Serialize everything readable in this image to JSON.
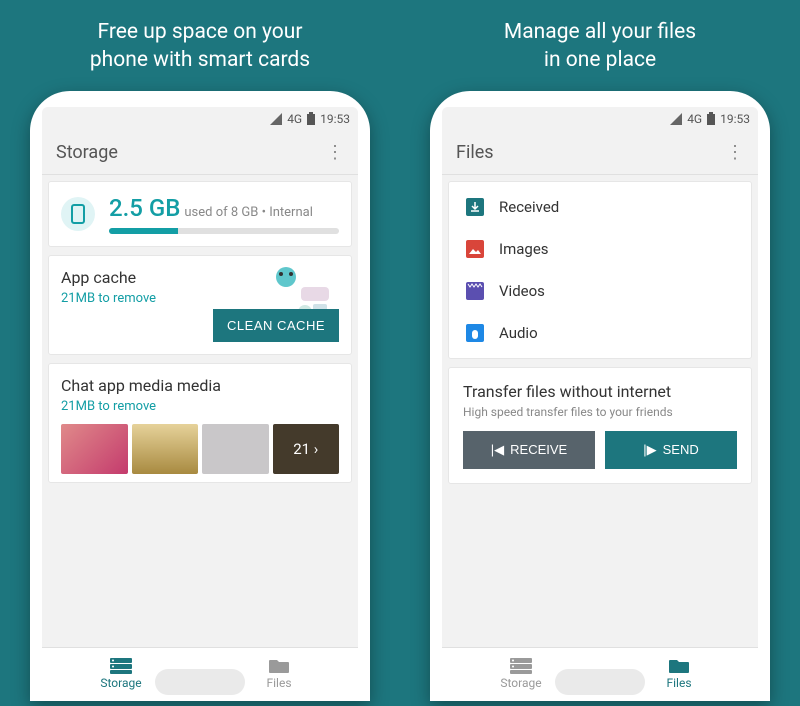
{
  "left": {
    "headline_l1": "Free up space on your",
    "headline_l2": "phone with smart cards",
    "status": {
      "net": "4G",
      "time": "19:53"
    },
    "appbar_title": "Storage",
    "storage": {
      "used": "2.5 GB",
      "sub": "used of 8 GB • Internal"
    },
    "cache": {
      "title": "App cache",
      "sub": "21MB to remove",
      "button": "CLEAN CACHE"
    },
    "media": {
      "title": "Chat app media media",
      "sub": "21MB to remove",
      "more": "21  ›"
    },
    "nav": {
      "storage": "Storage",
      "files": "Files"
    }
  },
  "right": {
    "headline_l1": "Manage all your files",
    "headline_l2": "in one place",
    "status": {
      "net": "4G",
      "time": "19:53"
    },
    "appbar_title": "Files",
    "rows": {
      "received": "Received",
      "images": "Images",
      "videos": "Videos",
      "audio": "Audio"
    },
    "transfer": {
      "title": "Transfer files without internet",
      "sub": "High speed transfer files to your friends",
      "receive": "RECEIVE",
      "send": "SEND"
    },
    "nav": {
      "storage": "Storage",
      "files": "Files"
    }
  }
}
